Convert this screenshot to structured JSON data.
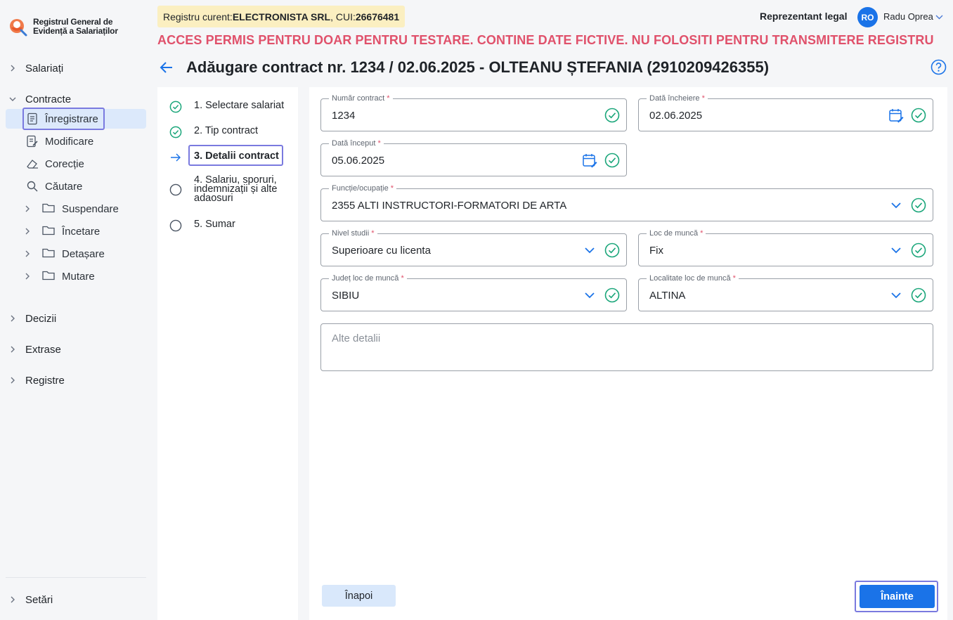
{
  "app": {
    "logo_line1": "Registrul General de",
    "logo_line2": "Evidență a Salariaților"
  },
  "sidebar": {
    "salariati": "Salariați",
    "contracte": "Contracte",
    "contracte_items": [
      {
        "label": "Înregistrare",
        "icon": "document-icon"
      },
      {
        "label": "Modificare",
        "icon": "document-edit-icon"
      },
      {
        "label": "Corecție",
        "icon": "eraser-icon"
      },
      {
        "label": "Căutare",
        "icon": "search-icon"
      }
    ],
    "contracte_folders": [
      {
        "label": "Suspendare"
      },
      {
        "label": "Încetare"
      },
      {
        "label": "Detașare"
      },
      {
        "label": "Mutare"
      }
    ],
    "decizii": "Decizii",
    "extrase": "Extrase",
    "registre": "Registre",
    "setari": "Setări"
  },
  "header": {
    "registry_prefix": "Registru curent: ",
    "registry_company": "ELECTRONISTA SRL",
    "registry_cui_prefix": ", CUI: ",
    "registry_cui": "26676481",
    "role": "Reprezentant legal",
    "avatar_initials": "RO",
    "user_name": "Radu Oprea",
    "warning": "ACCES PERMIS PENTRU DOAR PENTRU TESTARE. CONTINE DATE FICTIVE. NU FOLOSITI PENTRU TRANSMITERE REGISTRU",
    "page_title": "Adăugare contract nr. 1234 / 02.06.2025 - OLTEANU  ȘTEFANIA (2910209426355)"
  },
  "steps": [
    {
      "label": "1. Selectare salariat",
      "state": "done"
    },
    {
      "label": "2. Tip contract",
      "state": "done"
    },
    {
      "label": "3. Detalii contract",
      "state": "current"
    },
    {
      "label_lines": [
        "4. Salariu, sporuri,",
        "indemnizații și alte",
        "adaosuri"
      ],
      "state": "todo"
    },
    {
      "label": "5. Sumar",
      "state": "todo"
    }
  ],
  "form": {
    "numar_contract": {
      "label": "Număr contract",
      "value": "1234"
    },
    "data_incheiere": {
      "label": "Dată încheiere",
      "value": "02.06.2025"
    },
    "data_inceput": {
      "label": "Dată început",
      "value": "05.06.2025"
    },
    "functie": {
      "label": "Funcție/ocupație",
      "value": "2355 ALTI INSTRUCTORI-FORMATORI DE ARTA"
    },
    "nivel_studii": {
      "label": "Nivel studii",
      "value": "Superioare cu licenta"
    },
    "loc_munca": {
      "label": "Loc de muncă",
      "value": "Fix"
    },
    "judet": {
      "label": "Județ loc de muncă",
      "value": "SIBIU"
    },
    "localitate": {
      "label": "Localitate loc de muncă",
      "value": "ALTINA"
    },
    "alte_detalii": {
      "placeholder": "Alte detalii"
    },
    "required_mark": "*"
  },
  "buttons": {
    "back": "Înapoi",
    "next": "Înainte"
  },
  "colors": {
    "accent": "#1a73e8",
    "success": "#1aa67a",
    "warning_text": "#e0516b",
    "highlight": "#7a7adf"
  }
}
